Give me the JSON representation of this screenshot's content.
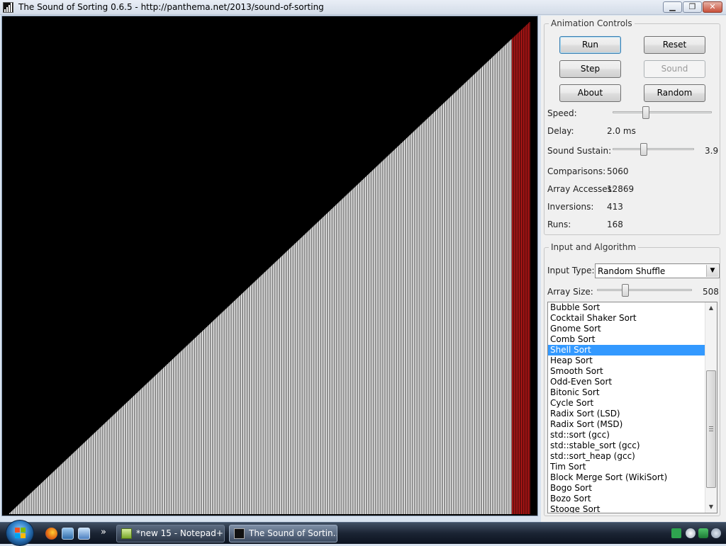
{
  "window": {
    "title": "The Sound of Sorting 0.6.5 - http://panthema.net/2013/sound-of-sorting",
    "min_symbol": "▁",
    "max_symbol": "❐",
    "close_symbol": "✕"
  },
  "visualization": {
    "array_size": 508,
    "ordering": "ascending",
    "bar_color": "#ffffff",
    "highlight_color": "#c01818",
    "background_color": "#000000",
    "highlighted_tail_fraction": 0.035
  },
  "animation_controls": {
    "legend": "Animation Controls",
    "buttons": {
      "run": "Run",
      "reset": "Reset",
      "step": "Step",
      "sound": "Sound",
      "about": "About",
      "random": "Random"
    },
    "speed_label": "Speed:",
    "speed_level": 0.32,
    "delay_label": "Delay:",
    "delay_value": "2.0 ms",
    "sustain_label": "Sound Sustain:",
    "sustain_value": "3.9",
    "sustain_level": 0.37,
    "stats": [
      {
        "label": "Comparisons:",
        "value": "5060"
      },
      {
        "label": "Array Accesses:",
        "value": "12869"
      },
      {
        "label": "Inversions:",
        "value": "413"
      },
      {
        "label": "Runs:",
        "value": "168"
      }
    ]
  },
  "input_algorithm": {
    "legend": "Input and Algorithm",
    "input_type_label": "Input Type:",
    "input_type_value": "Random Shuffle",
    "array_size_label": "Array Size:",
    "array_size_value": "508",
    "array_size_level": 0.28,
    "algorithms": [
      "Bubble Sort",
      "Cocktail Shaker Sort",
      "Gnome Sort",
      "Comb Sort",
      "Shell Sort",
      "Heap Sort",
      "Smooth Sort",
      "Odd-Even Sort",
      "Bitonic Sort",
      "Cycle Sort",
      "Radix Sort (LSD)",
      "Radix Sort (MSD)",
      "std::sort (gcc)",
      "std::stable_sort (gcc)",
      "std::sort_heap (gcc)",
      "Tim Sort",
      "Block Merge Sort (WikiSort)",
      "Bogo Sort",
      "Bozo Sort",
      "Stooge Sort"
    ],
    "selected_index": 4,
    "scroll_up_symbol": "▲",
    "scroll_down_symbol": "▼"
  },
  "taskbar": {
    "more_symbol": "»",
    "tasks": [
      {
        "label": "*new 15 - Notepad++"
      },
      {
        "label": "The Sound of Sortin..."
      }
    ]
  },
  "icons": {
    "dropdown": "chevron-down-icon",
    "firefox": "firefox-icon",
    "desktop": "show-desktop-icon",
    "switch": "switch-windows-icon",
    "notepad": "notepad-plus-plus-icon",
    "sound_app": "sound-of-sorting-icon"
  }
}
